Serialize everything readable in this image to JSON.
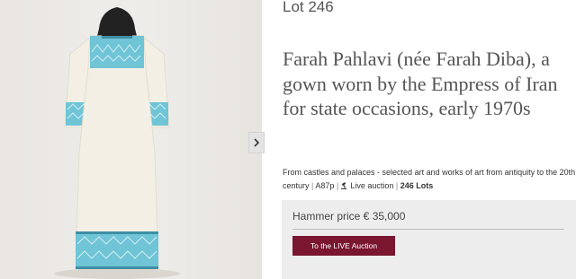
{
  "lot": {
    "number": "Lot 246"
  },
  "title": "Farah Pahlavi (née Farah Diba), a gown worn by the Empress of Iran for state occasions, early 1970s",
  "sale": {
    "name": "From castles and palaces - selected art and works of art from antiquity to the 20th century",
    "code": "A87p",
    "live_label": "Live auction",
    "lots": "246 Lots"
  },
  "hammer": {
    "label": "Hammer price € 35,000"
  },
  "button": {
    "live": "To the LIVE Auction"
  },
  "icons": {
    "next": "chevron-right-icon",
    "live": "gavel-icon"
  },
  "colors": {
    "accent": "#7a1630",
    "embroidery": "#6fc4d6",
    "gown": "#f3efe4",
    "panel": "#ededed"
  }
}
